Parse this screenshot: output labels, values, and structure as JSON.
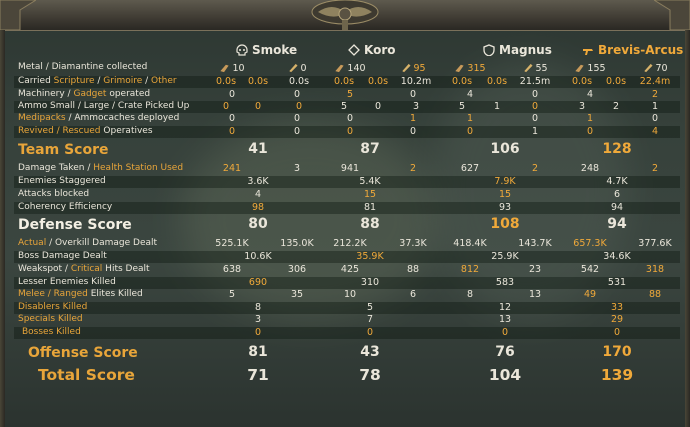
{
  "players": [
    {
      "name": "Smoke",
      "highlight": false,
      "icon": "skull-icon"
    },
    {
      "name": "Koro",
      "highlight": false,
      "icon": "diamond-icon"
    },
    {
      "name": "Magnus",
      "highlight": false,
      "icon": "shield-icon"
    },
    {
      "name": "Brevis-Arcus",
      "highlight": true,
      "icon": "bolter-icon"
    }
  ],
  "rows": [
    {
      "label": [
        {
          "t": "Metal / Diamantine collected"
        }
      ],
      "cells": [
        {
          "t": "10",
          "icon": "metal-icon"
        },
        {
          "t": "0",
          "icon": "diamantine-icon"
        },
        {
          "t": "140",
          "icon": "metal-icon"
        },
        {
          "t": "95",
          "o": true,
          "icon": "diamantine-icon"
        },
        {
          "t": "315",
          "o": true,
          "icon": "metal-icon"
        },
        {
          "t": "55",
          "icon": "diamantine-icon"
        },
        {
          "t": "155",
          "icon": "metal-icon"
        },
        {
          "t": "70",
          "icon": "diamantine-icon"
        }
      ]
    },
    {
      "label": [
        {
          "t": "Carried "
        },
        {
          "t": "Scripture",
          "o": true
        },
        {
          "t": " / "
        },
        {
          "t": "Grimoire",
          "o": true
        },
        {
          "t": " / "
        },
        {
          "t": "Other",
          "o": true
        }
      ],
      "cells": [
        {
          "t": "0.0s",
          "o": true
        },
        {
          "t": "0.0s",
          "o": true
        },
        {
          "t": "0.0s"
        },
        {
          "t": "0.0s",
          "o": true
        },
        {
          "t": "0.0s",
          "o": true
        },
        {
          "t": "10.2m"
        },
        {
          "t": "0.0s",
          "o": true
        },
        {
          "t": "0.0s",
          "o": true
        },
        {
          "t": "21.5m"
        },
        {
          "t": "0.0s",
          "o": true
        },
        {
          "t": "0.0s",
          "o": true
        },
        {
          "t": "22.4m",
          "o": true
        }
      ]
    },
    {
      "label": [
        {
          "t": "Machinery / "
        },
        {
          "t": "Gadget",
          "o": true
        },
        {
          "t": " operated"
        }
      ],
      "cells": [
        {
          "t": "0"
        },
        {
          "t": "0"
        },
        {
          "t": "5",
          "o": true
        },
        {
          "t": "0"
        },
        {
          "t": "4"
        },
        {
          "t": "0"
        },
        {
          "t": "4"
        },
        {
          "t": "2",
          "o": true
        }
      ]
    },
    {
      "label": [
        {
          "t": "Ammo Small / Large / Crate Picked Up"
        }
      ],
      "cells": [
        {
          "t": "0",
          "o": true
        },
        {
          "t": "0",
          "o": true
        },
        {
          "t": "0",
          "o": true
        },
        {
          "t": "5"
        },
        {
          "t": "0"
        },
        {
          "t": "3"
        },
        {
          "t": "5"
        },
        {
          "t": "1"
        },
        {
          "t": "0",
          "o": true
        },
        {
          "t": "3"
        },
        {
          "t": "2"
        },
        {
          "t": "1"
        }
      ]
    },
    {
      "label": [
        {
          "t": "Medipacks",
          "o": true
        },
        {
          "t": " / Ammocaches deployed"
        }
      ],
      "cells": [
        {
          "t": "0"
        },
        {
          "t": "0"
        },
        {
          "t": "0"
        },
        {
          "t": "1",
          "o": true
        },
        {
          "t": "1",
          "o": true
        },
        {
          "t": "0"
        },
        {
          "t": "1",
          "o": true
        },
        {
          "t": "0"
        }
      ]
    },
    {
      "label": [
        {
          "t": "Revived / Rescued",
          "o": true
        },
        {
          "t": " Operatives"
        }
      ],
      "cells": [
        {
          "t": "0",
          "o": true
        },
        {
          "t": "0"
        },
        {
          "t": "0",
          "o": true
        },
        {
          "t": "0"
        },
        {
          "t": "0",
          "o": true
        },
        {
          "t": "1"
        },
        {
          "t": "0",
          "o": true
        },
        {
          "t": "4",
          "o": true
        }
      ]
    },
    {
      "big": true,
      "label": [
        {
          "t": "Team Score",
          "o": true
        }
      ],
      "cells": [
        {
          "t": "41"
        },
        {
          "t": "87"
        },
        {
          "t": "106"
        },
        {
          "t": "128",
          "o": true
        }
      ]
    },
    {
      "label": [
        {
          "t": "Damage Taken / "
        },
        {
          "t": "Health Station Used",
          "o": true
        }
      ],
      "cells": [
        {
          "t": "241",
          "o": true
        },
        {
          "t": "3"
        },
        {
          "t": "941"
        },
        {
          "t": "2",
          "o": true
        },
        {
          "t": "627"
        },
        {
          "t": "2",
          "o": true
        },
        {
          "t": "248"
        },
        {
          "t": "2",
          "o": true
        }
      ]
    },
    {
      "label": [
        {
          "t": "Enemies Staggered"
        }
      ],
      "cells": [
        {
          "t": "3.6K"
        },
        {
          "t": "5.4K"
        },
        {
          "t": "7.9K",
          "o": true
        },
        {
          "t": "4.7K"
        }
      ]
    },
    {
      "label": [
        {
          "t": "Attacks blocked"
        }
      ],
      "cells": [
        {
          "t": "4"
        },
        {
          "t": "15",
          "o": true
        },
        {
          "t": "15",
          "o": true
        },
        {
          "t": "6"
        }
      ]
    },
    {
      "label": [
        {
          "t": "Coherency Efficiency"
        }
      ],
      "cells": [
        {
          "t": "98",
          "o": true
        },
        {
          "t": "81"
        },
        {
          "t": "93"
        },
        {
          "t": "94"
        }
      ]
    },
    {
      "big": true,
      "label": [
        {
          "t": "Defense Score"
        }
      ],
      "cells": [
        {
          "t": "80"
        },
        {
          "t": "88"
        },
        {
          "t": "108",
          "o": true
        },
        {
          "t": "94"
        }
      ]
    },
    {
      "label": [
        {
          "t": "Actual",
          "o": true
        },
        {
          "t": " / Overkill Damage Dealt"
        }
      ],
      "cells": [
        {
          "t": "525.1K"
        },
        {
          "t": "135.0K"
        },
        {
          "t": "212.2K"
        },
        {
          "t": "37.3K"
        },
        {
          "t": "418.4K"
        },
        {
          "t": "143.7K"
        },
        {
          "t": "657.3K",
          "o": true
        },
        {
          "t": "377.6K"
        }
      ]
    },
    {
      "label": [
        {
          "t": "Boss Damage Dealt"
        }
      ],
      "cells": [
        {
          "t": "10.6K"
        },
        {
          "t": "35.9K",
          "o": true
        },
        {
          "t": "25.9K"
        },
        {
          "t": "34.6K"
        }
      ]
    },
    {
      "label": [
        {
          "t": "Weakspot / "
        },
        {
          "t": "Critical",
          "o": true
        },
        {
          "t": " Hits Dealt"
        }
      ],
      "cells": [
        {
          "t": "638"
        },
        {
          "t": "306"
        },
        {
          "t": "425"
        },
        {
          "t": "88"
        },
        {
          "t": "812",
          "o": true
        },
        {
          "t": "23"
        },
        {
          "t": "542"
        },
        {
          "t": "318",
          "o": true
        }
      ]
    },
    {
      "label": [
        {
          "t": "Lesser Enemies Killed"
        }
      ],
      "cells": [
        {
          "t": "690",
          "o": true
        },
        {
          "t": "310"
        },
        {
          "t": "583"
        },
        {
          "t": "531"
        }
      ]
    },
    {
      "label": [
        {
          "t": "Melee / Ranged",
          "o": true
        },
        {
          "t": " Elites Killed"
        }
      ],
      "cells": [
        {
          "t": "5"
        },
        {
          "t": "35"
        },
        {
          "t": "10"
        },
        {
          "t": "6"
        },
        {
          "t": "8"
        },
        {
          "t": "13"
        },
        {
          "t": "49",
          "o": true
        },
        {
          "t": "88",
          "o": true
        }
      ]
    },
    {
      "label": [
        {
          "t": "Disablers Killed",
          "o": true
        }
      ],
      "cells": [
        {
          "t": "8"
        },
        {
          "t": "5"
        },
        {
          "t": "12"
        },
        {
          "t": "33",
          "o": true
        }
      ]
    },
    {
      "label": [
        {
          "t": "Specials Killed",
          "o": true
        }
      ],
      "cells": [
        {
          "t": "3"
        },
        {
          "t": "7"
        },
        {
          "t": "13"
        },
        {
          "t": "29",
          "o": true
        }
      ]
    },
    {
      "label": [
        {
          "t": "Bosses Killed",
          "o": true
        }
      ],
      "cells": [
        {
          "t": "0",
          "o": true
        },
        {
          "t": "0",
          "o": true
        },
        {
          "t": "0",
          "o": true
        },
        {
          "t": "0",
          "o": true
        }
      ]
    },
    {
      "big": true,
      "label": [
        {
          "t": "Offense Score",
          "o": true
        }
      ],
      "cells": [
        {
          "t": "81"
        },
        {
          "t": "43"
        },
        {
          "t": "76"
        },
        {
          "t": "170",
          "o": true
        }
      ]
    },
    {
      "big": true,
      "tot": true,
      "label": [
        {
          "t": "Total Score",
          "o": true
        }
      ],
      "cells": [
        {
          "t": "71"
        },
        {
          "t": "78"
        },
        {
          "t": "104"
        },
        {
          "t": "139",
          "o": true
        }
      ]
    }
  ],
  "colors": {
    "highlight": "#f0a93a",
    "text": "#eae6da"
  }
}
